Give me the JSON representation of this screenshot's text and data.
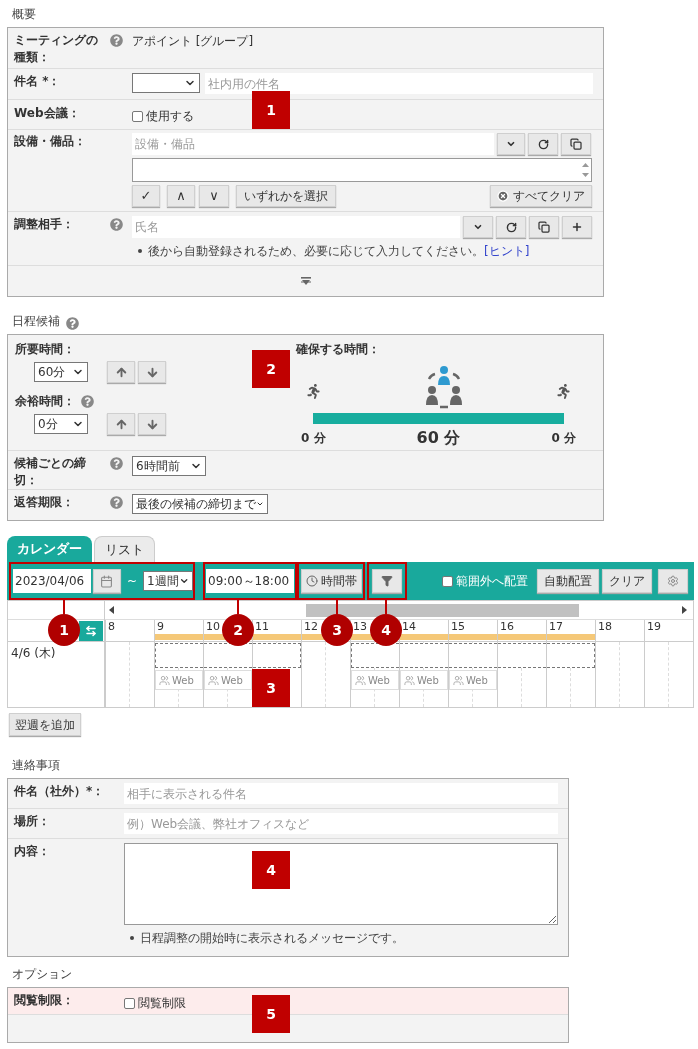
{
  "overview": {
    "heading": "概要",
    "meeting_type": {
      "label": "ミーティングの種類：",
      "help": true,
      "value": "アポイント [グループ]"
    },
    "subject": {
      "label": "件名 *：",
      "placeholder": "社内用の件名"
    },
    "web_meeting": {
      "label": "Web会議：",
      "option": "使用する",
      "checked": false
    },
    "equipment": {
      "label": "設備・備品：",
      "placeholder": "設備・備品",
      "check_button": "✓",
      "up_button": "∧",
      "down_button": "∨",
      "select_any": "いずれかを選択",
      "clear_all": "すべてクリア"
    },
    "attendee": {
      "label": "調整相手：",
      "help": true,
      "placeholder": "氏名",
      "note": "後から自動登録されるため、必要に応じて入力してください。",
      "hint_link": "[ヒント]"
    }
  },
  "schedule": {
    "heading": "日程候補",
    "help": true,
    "duration": {
      "label": "所要時間：",
      "value": "60分"
    },
    "buffer": {
      "label": "余裕時間：",
      "help": true,
      "value": "0分"
    },
    "secure": {
      "title": "確保する時間：",
      "before": "0 分",
      "main": "60 分",
      "after": "0 分"
    },
    "deadline": {
      "label": "候補ごとの締切：",
      "help": true,
      "value": "6時間前"
    },
    "reply": {
      "label": "返答期限：",
      "help": true,
      "value": "最後の候補の締切まで"
    }
  },
  "calendar": {
    "tabs": [
      {
        "label": "カレンダー",
        "selected": true
      },
      {
        "label": "リスト",
        "selected": false
      }
    ],
    "start_date": "2023/04/06",
    "tilde": "~",
    "period": "1週間",
    "time_range": "09:00～18:00",
    "time_button": "時間帯",
    "outside": {
      "label": "範囲外へ配置",
      "checked": false
    },
    "auto_button": "自動配置",
    "clear_button": "クリア",
    "day": "4/6 (木)",
    "hours": [
      {
        "label": "8",
        "in_range": false,
        "candidate": false
      },
      {
        "label": "9",
        "in_range": true,
        "candidate": true,
        "slot": "Web"
      },
      {
        "label": "10",
        "in_range": true,
        "candidate": true,
        "slot": "Web"
      },
      {
        "label": "11",
        "in_range": true,
        "candidate": true
      },
      {
        "label": "12",
        "in_range": true,
        "candidate": false
      },
      {
        "label": "13",
        "in_range": true,
        "candidate": true,
        "slot": "Web"
      },
      {
        "label": "14",
        "in_range": true,
        "candidate": true,
        "slot": "Web"
      },
      {
        "label": "15",
        "in_range": true,
        "candidate": true,
        "slot": "Web"
      },
      {
        "label": "16",
        "in_range": true,
        "candidate": true
      },
      {
        "label": "17",
        "in_range": true,
        "candidate": true
      },
      {
        "label": "18",
        "in_range": false,
        "candidate": false
      },
      {
        "label": "19",
        "in_range": false,
        "candidate": false
      }
    ],
    "add_week": "翌週を追加"
  },
  "contact": {
    "heading": "連絡事項",
    "subject": {
      "label": "件名（社外）*：",
      "placeholder": "相手に表示される件名"
    },
    "place": {
      "label": "場所：",
      "placeholder": "例）Web会議、弊社オフィスなど"
    },
    "content": {
      "label": "内容：",
      "note": "日程調整の開始時に表示されるメッセージです。"
    }
  },
  "options": {
    "heading": "オプション",
    "view_limit": {
      "label": "閲覧制限：",
      "option": "閲覧制限",
      "checked": false
    }
  },
  "annotations": {
    "squares": [
      "1",
      "2",
      "3",
      "4",
      "5"
    ],
    "circles": [
      "1",
      "2",
      "3",
      "4"
    ]
  }
}
